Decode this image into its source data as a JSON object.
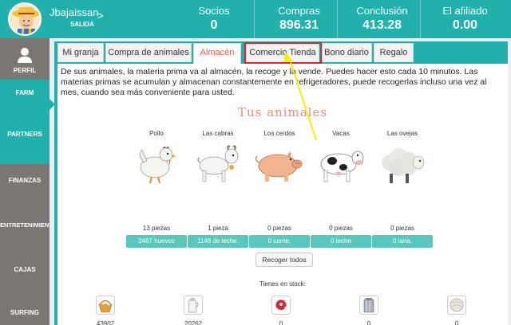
{
  "header": {
    "username": "Jbajaissan",
    "logout_label": "SALIDA",
    "chevron": ">",
    "stats": [
      {
        "label": "Socios",
        "value": "0"
      },
      {
        "label": "Compras",
        "value": "896.31"
      },
      {
        "label": "Conclusión",
        "value": "413.28"
      },
      {
        "label": "El afiliado",
        "value": "0.00"
      }
    ]
  },
  "sidebar": {
    "items": [
      {
        "label": "PERFIL",
        "icon": "user-icon"
      },
      {
        "label": "FARM"
      },
      {
        "label": "PARTNERS"
      },
      {
        "label": "FINANZAS"
      },
      {
        "label": "ENTRETENIMIENTO"
      },
      {
        "label": "CAJAS"
      },
      {
        "label": "SURFING"
      }
    ]
  },
  "tabs": [
    {
      "label": "Mi granja"
    },
    {
      "label": "Compra de animales"
    },
    {
      "label": "Almacén"
    },
    {
      "label": "Comercio Tienda"
    },
    {
      "label": "Bono diario"
    },
    {
      "label": "Regalo"
    }
  ],
  "warehouse": {
    "description": "De sus animales, la materia prima va al almacén, la recoge y la vende. Puedes hacer esto cada 10 minutos. Las materias primas se acumulan y almacenan constantemente en refrigeradores, puede recogerlas incluso una vez al mes, cuando sea más conveniente para usted.",
    "heading": "Tus animales",
    "animals": [
      {
        "name": "Pollo",
        "count": "13 piezas",
        "product": "2487 huevos"
      },
      {
        "name": "Las cabras",
        "count": "1 pieza",
        "product": "1148 de leche."
      },
      {
        "name": "Los cerdos",
        "count": "0 piezas",
        "product": "0 carne."
      },
      {
        "name": "Vacas",
        "count": "0 piezas",
        "product": "0 leche"
      },
      {
        "name": "Las ovejas",
        "count": "0 piezas",
        "product": "0 lana."
      }
    ],
    "collect_label": "Recoger todos",
    "stock_title": "Tienes en stock:",
    "stock": [
      {
        "icon": "egg-basket-icon",
        "value": "43902"
      },
      {
        "icon": "milk-jug-icon",
        "value": "20262"
      },
      {
        "icon": "meat-icon",
        "value": "0"
      },
      {
        "icon": "milk-can-icon",
        "value": "0"
      },
      {
        "icon": "wool-icon",
        "value": "0"
      }
    ]
  },
  "colors": {
    "accent": "#21b0ab",
    "sidebar": "#7c7672",
    "pill": "#58c8bb",
    "active_tab_text": "#e6584a",
    "highlight": "#e51e2a",
    "annotation_arrow": "#f4f000"
  }
}
